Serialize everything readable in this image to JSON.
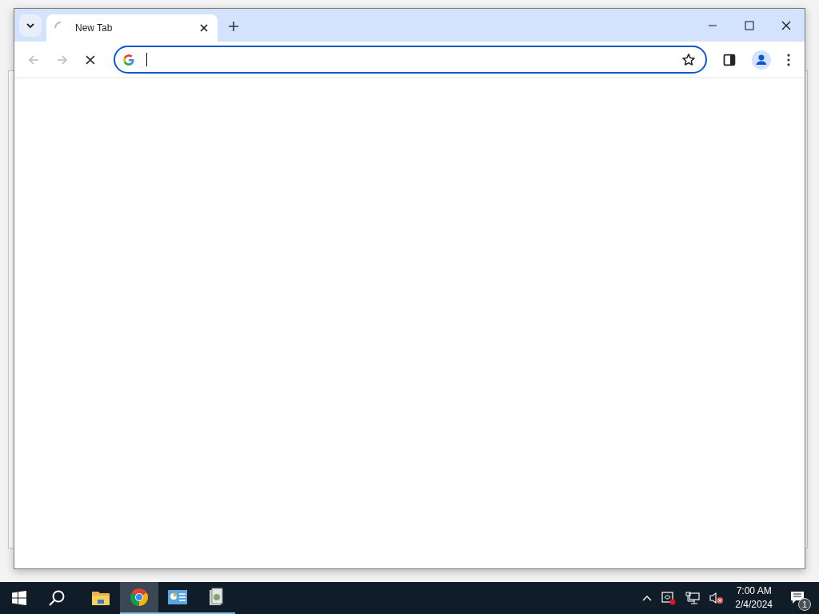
{
  "browser": {
    "tabs": [
      {
        "title": "New Tab",
        "selected": true,
        "loading": true
      }
    ],
    "nav": {
      "back_disabled": true,
      "forward_disabled": true,
      "loading": true
    }
  },
  "taskbar": {
    "apps": [
      {
        "kind": "folder",
        "running": false,
        "selected": false
      },
      {
        "kind": "chrome",
        "running": true,
        "selected": true
      },
      {
        "kind": "chart",
        "running": true,
        "selected": false
      },
      {
        "kind": "tool",
        "running": true,
        "selected": false
      }
    ],
    "clock": {
      "time": "7:00 AM",
      "date": "2/4/2024"
    },
    "notifications": "1"
  }
}
